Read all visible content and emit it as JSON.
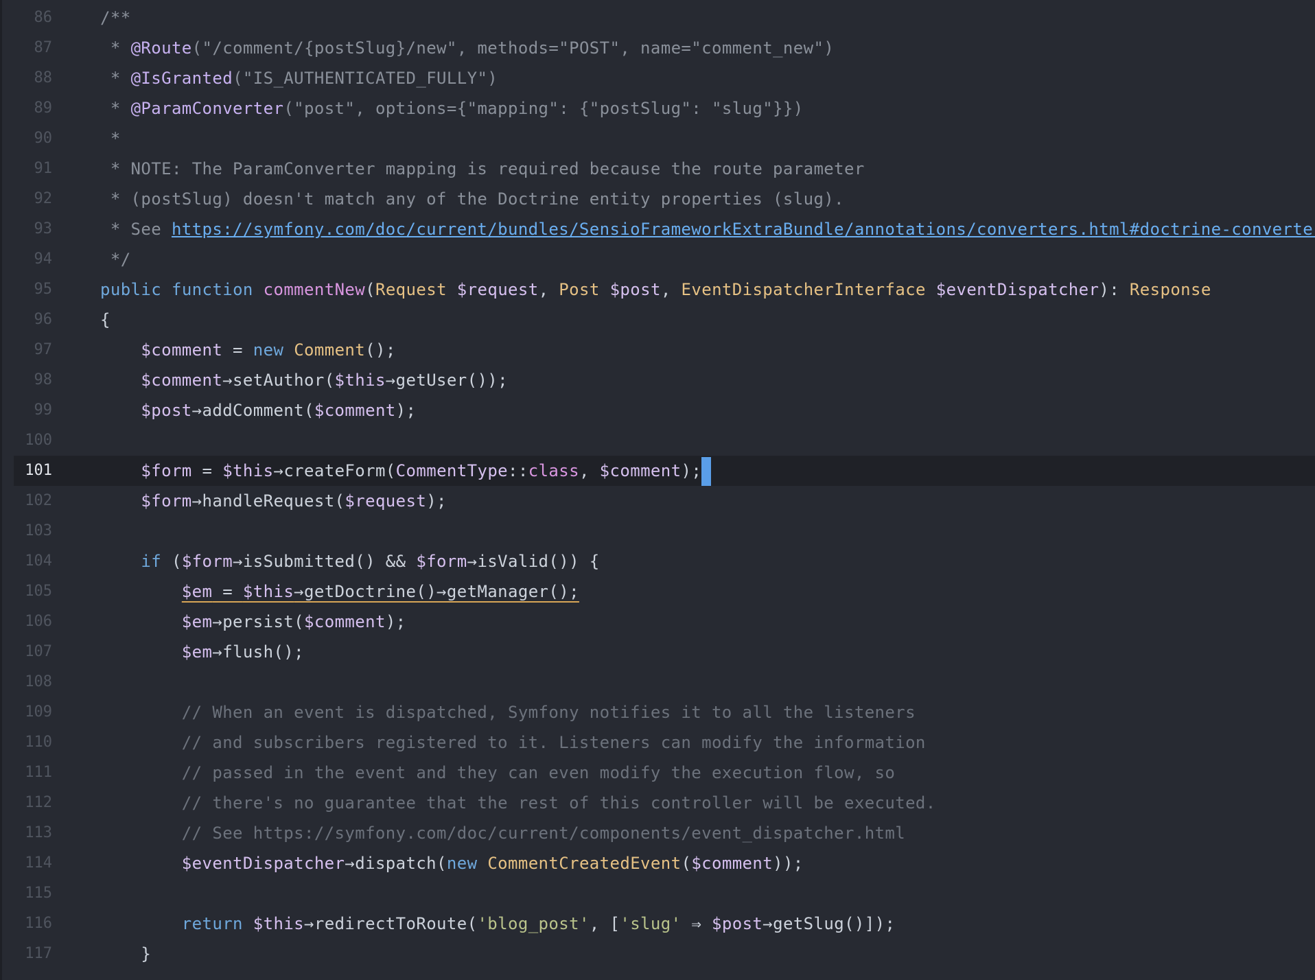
{
  "editor": {
    "lines": [
      {
        "num": "86",
        "current": false,
        "tokens": [
          {
            "t": "/**",
            "c": "cmt"
          }
        ]
      },
      {
        "num": "87",
        "current": false,
        "tokens": [
          {
            "t": " * ",
            "c": "cmt"
          },
          {
            "t": "@Route",
            "c": "ann"
          },
          {
            "t": "(\"/comment/{postSlug}/new\", methods=\"POST\", name=\"comment_new\")",
            "c": "cmt"
          }
        ]
      },
      {
        "num": "88",
        "current": false,
        "tokens": [
          {
            "t": " * ",
            "c": "cmt"
          },
          {
            "t": "@IsGranted",
            "c": "ann"
          },
          {
            "t": "(\"IS_AUTHENTICATED_FULLY\")",
            "c": "cmt"
          }
        ]
      },
      {
        "num": "89",
        "current": false,
        "tokens": [
          {
            "t": " * ",
            "c": "cmt"
          },
          {
            "t": "@ParamConverter",
            "c": "ann"
          },
          {
            "t": "(\"post\", options={\"mapping\": {\"postSlug\": \"slug\"}})",
            "c": "cmt"
          }
        ]
      },
      {
        "num": "90",
        "current": false,
        "tokens": [
          {
            "t": " *",
            "c": "cmt"
          }
        ]
      },
      {
        "num": "91",
        "current": false,
        "tokens": [
          {
            "t": " * NOTE: The ParamConverter mapping is required because the route parameter",
            "c": "cmt"
          }
        ]
      },
      {
        "num": "92",
        "current": false,
        "tokens": [
          {
            "t": " * (postSlug) doesn't match any of the Doctrine entity properties (slug).",
            "c": "cmt"
          }
        ]
      },
      {
        "num": "93",
        "current": false,
        "tokens": [
          {
            "t": " * See ",
            "c": "cmt"
          },
          {
            "t": "https://symfony.com/doc/current/bundles/SensioFrameworkExtraBundle/annotations/converters.html#doctrine-converter",
            "c": "lnk",
            "link": true
          }
        ]
      },
      {
        "num": "94",
        "current": false,
        "tokens": [
          {
            "t": " */",
            "c": "cmt"
          }
        ]
      },
      {
        "num": "95",
        "current": false,
        "tokens": [
          {
            "t": "public",
            "c": "kw"
          },
          {
            "t": " ",
            "c": "pl"
          },
          {
            "t": "function",
            "c": "kw"
          },
          {
            "t": " ",
            "c": "pl"
          },
          {
            "t": "commentNew",
            "c": "fn"
          },
          {
            "t": "(",
            "c": "pl"
          },
          {
            "t": "Request",
            "c": "ty"
          },
          {
            "t": " ",
            "c": "pl"
          },
          {
            "t": "$request",
            "c": "var"
          },
          {
            "t": ", ",
            "c": "pl"
          },
          {
            "t": "Post",
            "c": "ty"
          },
          {
            "t": " ",
            "c": "pl"
          },
          {
            "t": "$post",
            "c": "var"
          },
          {
            "t": ", ",
            "c": "pl"
          },
          {
            "t": "EventDispatcherInterface",
            "c": "ty"
          },
          {
            "t": " ",
            "c": "pl"
          },
          {
            "t": "$eventDispatcher",
            "c": "var"
          },
          {
            "t": "): ",
            "c": "pl"
          },
          {
            "t": "Response",
            "c": "ty"
          }
        ]
      },
      {
        "num": "96",
        "current": false,
        "tokens": [
          {
            "t": "{",
            "c": "pl"
          }
        ]
      },
      {
        "num": "97",
        "current": false,
        "tokens": [
          {
            "t": "    ",
            "c": "pl"
          },
          {
            "t": "$comment",
            "c": "var"
          },
          {
            "t": " = ",
            "c": "pl"
          },
          {
            "t": "new",
            "c": "kw"
          },
          {
            "t": " ",
            "c": "pl"
          },
          {
            "t": "Comment",
            "c": "ty"
          },
          {
            "t": "();",
            "c": "pl"
          }
        ]
      },
      {
        "num": "98",
        "current": false,
        "tokens": [
          {
            "t": "    ",
            "c": "pl"
          },
          {
            "t": "$comment",
            "c": "var"
          },
          {
            "t": "→setAuthor(",
            "c": "pl"
          },
          {
            "t": "$this",
            "c": "var"
          },
          {
            "t": "→getUser());",
            "c": "pl"
          }
        ]
      },
      {
        "num": "99",
        "current": false,
        "tokens": [
          {
            "t": "    ",
            "c": "pl"
          },
          {
            "t": "$post",
            "c": "var"
          },
          {
            "t": "→addComment(",
            "c": "pl"
          },
          {
            "t": "$comment",
            "c": "var"
          },
          {
            "t": ");",
            "c": "pl"
          }
        ]
      },
      {
        "num": "100",
        "current": false,
        "tokens": []
      },
      {
        "num": "101",
        "current": true,
        "tokens": [
          {
            "t": "    ",
            "c": "pl"
          },
          {
            "t": "$form",
            "c": "var"
          },
          {
            "t": " = ",
            "c": "pl"
          },
          {
            "t": "$this",
            "c": "var"
          },
          {
            "t": "→createForm(",
            "c": "pl"
          },
          {
            "t": "CommentType",
            "c": "var"
          },
          {
            "t": "::",
            "c": "pl"
          },
          {
            "t": "class",
            "c": "fn"
          },
          {
            "t": ", ",
            "c": "pl"
          },
          {
            "t": "$comment",
            "c": "var"
          },
          {
            "t": ");",
            "c": "pl"
          }
        ]
      },
      {
        "num": "102",
        "current": false,
        "tokens": [
          {
            "t": "    ",
            "c": "pl"
          },
          {
            "t": "$form",
            "c": "var"
          },
          {
            "t": "→handleRequest(",
            "c": "pl"
          },
          {
            "t": "$request",
            "c": "var"
          },
          {
            "t": ");",
            "c": "pl"
          }
        ]
      },
      {
        "num": "103",
        "current": false,
        "tokens": []
      },
      {
        "num": "104",
        "current": false,
        "tokens": [
          {
            "t": "    ",
            "c": "pl"
          },
          {
            "t": "if",
            "c": "kw"
          },
          {
            "t": " (",
            "c": "pl"
          },
          {
            "t": "$form",
            "c": "var"
          },
          {
            "t": "→isSubmitted() && ",
            "c": "pl"
          },
          {
            "t": "$form",
            "c": "var"
          },
          {
            "t": "→isValid()) {",
            "c": "pl"
          }
        ]
      },
      {
        "num": "105",
        "current": false,
        "tokens": [
          {
            "t": "        ",
            "c": "pl"
          },
          {
            "t": "$em",
            "c": "var warn"
          },
          {
            "t": " = ",
            "c": "pl warn"
          },
          {
            "t": "$this",
            "c": "var warn"
          },
          {
            "t": "→getDoctrine()→getManager();",
            "c": "pl warn"
          }
        ]
      },
      {
        "num": "106",
        "current": false,
        "tokens": [
          {
            "t": "        ",
            "c": "pl"
          },
          {
            "t": "$em",
            "c": "var"
          },
          {
            "t": "→persist(",
            "c": "pl"
          },
          {
            "t": "$comment",
            "c": "var"
          },
          {
            "t": ");",
            "c": "pl"
          }
        ]
      },
      {
        "num": "107",
        "current": false,
        "tokens": [
          {
            "t": "        ",
            "c": "pl"
          },
          {
            "t": "$em",
            "c": "var"
          },
          {
            "t": "→flush();",
            "c": "pl"
          }
        ]
      },
      {
        "num": "108",
        "current": false,
        "tokens": []
      },
      {
        "num": "109",
        "current": false,
        "tokens": [
          {
            "t": "        // When an event is dispatched, Symfony notifies it to all the listeners",
            "c": "cm2"
          }
        ]
      },
      {
        "num": "110",
        "current": false,
        "tokens": [
          {
            "t": "        // and subscribers registered to it. Listeners can modify the information",
            "c": "cm2"
          }
        ]
      },
      {
        "num": "111",
        "current": false,
        "tokens": [
          {
            "t": "        // passed in the event and they can even modify the execution flow, so",
            "c": "cm2"
          }
        ]
      },
      {
        "num": "112",
        "current": false,
        "tokens": [
          {
            "t": "        // there's no guarantee that the rest of this controller will be executed.",
            "c": "cm2"
          }
        ]
      },
      {
        "num": "113",
        "current": false,
        "tokens": [
          {
            "t": "        // See https://symfony.com/doc/current/components/event_dispatcher.html",
            "c": "cm2"
          }
        ]
      },
      {
        "num": "114",
        "current": false,
        "tokens": [
          {
            "t": "        ",
            "c": "pl"
          },
          {
            "t": "$eventDispatcher",
            "c": "var"
          },
          {
            "t": "→dispatch(",
            "c": "pl"
          },
          {
            "t": "new",
            "c": "kw"
          },
          {
            "t": " ",
            "c": "pl"
          },
          {
            "t": "CommentCreatedEvent",
            "c": "ty"
          },
          {
            "t": "(",
            "c": "pl"
          },
          {
            "t": "$comment",
            "c": "var"
          },
          {
            "t": "));",
            "c": "pl"
          }
        ]
      },
      {
        "num": "115",
        "current": false,
        "tokens": []
      },
      {
        "num": "116",
        "current": false,
        "tokens": [
          {
            "t": "        ",
            "c": "pl"
          },
          {
            "t": "return",
            "c": "kw"
          },
          {
            "t": " ",
            "c": "pl"
          },
          {
            "t": "$this",
            "c": "var"
          },
          {
            "t": "→redirectToRoute(",
            "c": "pl"
          },
          {
            "t": "'blog_post'",
            "c": "str"
          },
          {
            "t": ", [",
            "c": "pl"
          },
          {
            "t": "'slug'",
            "c": "str"
          },
          {
            "t": " ⇒ ",
            "c": "pl"
          },
          {
            "t": "$post",
            "c": "var"
          },
          {
            "t": "→getSlug()]);",
            "c": "pl"
          }
        ]
      },
      {
        "num": "117",
        "current": false,
        "tokens": [
          {
            "t": "    }",
            "c": "pl"
          }
        ]
      }
    ]
  }
}
